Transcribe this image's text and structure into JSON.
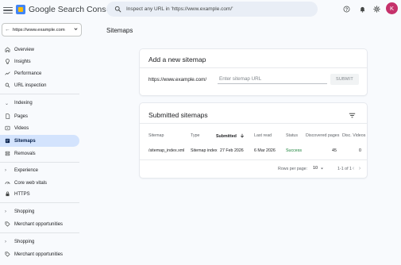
{
  "header": {
    "product_name": "Google Search Console",
    "search_placeholder": "Inspect any URL in 'https://www.example.com/'",
    "avatar_letter": "K"
  },
  "sidebar": {
    "property": "https://www.example.com",
    "items": [
      {
        "label": "Overview",
        "icon": "home-icon"
      },
      {
        "label": "Insights",
        "icon": "insights-icon"
      },
      {
        "label": "Performance",
        "icon": "performance-icon"
      },
      {
        "label": "URL inspection",
        "icon": "search-icon"
      }
    ],
    "indexing": {
      "label": "Indexing",
      "items": [
        {
          "label": "Pages",
          "icon": "pages-icon"
        },
        {
          "label": "Videos",
          "icon": "videos-icon"
        },
        {
          "label": "Sitemaps",
          "icon": "sitemaps-icon",
          "active": true
        },
        {
          "label": "Removals",
          "icon": "removals-icon"
        }
      ]
    },
    "experience": {
      "label": "Experience",
      "items": [
        {
          "label": "Core web vitals",
          "icon": "gauge-icon"
        },
        {
          "label": "HTTPS",
          "icon": "lock-icon"
        }
      ]
    },
    "shopping1": {
      "label": "Shopping",
      "items": [
        {
          "label": "Merchant opportunities",
          "icon": "tag-icon"
        }
      ]
    },
    "shopping2": {
      "label": "Shopping",
      "items": [
        {
          "label": "Merchant opportunities",
          "icon": "tag-icon"
        }
      ]
    }
  },
  "main": {
    "title": "Sitemaps",
    "add_card": {
      "title": "Add a new sitemap",
      "prefix": "https://www.example.com/",
      "input_placeholder": "Enter sitemap URL",
      "submit_label": "SUBMIT"
    },
    "submitted_card": {
      "title": "Submitted sitemaps",
      "columns": [
        "Sitemap",
        "Type",
        "Submitted",
        "Last read",
        "Status",
        "Discovered pages",
        "Disc. Videos"
      ],
      "sorted_column": "Submitted",
      "rows": [
        {
          "sitemap": "/sitemap_index.xml",
          "type": "Sitemap index",
          "submitted": "27 Feb 2026",
          "last_read": "6 Mar 2026",
          "status": "Success",
          "discovered_pages": "45",
          "disc_videos": "0"
        }
      ],
      "pagination": {
        "rows_per_page_label": "Rows per page:",
        "rows_per_page": "10",
        "range": "1-1 of 1"
      }
    }
  },
  "colors": {
    "accent": "#d3e3fd",
    "success": "#188038",
    "avatar": "#c5316b"
  }
}
